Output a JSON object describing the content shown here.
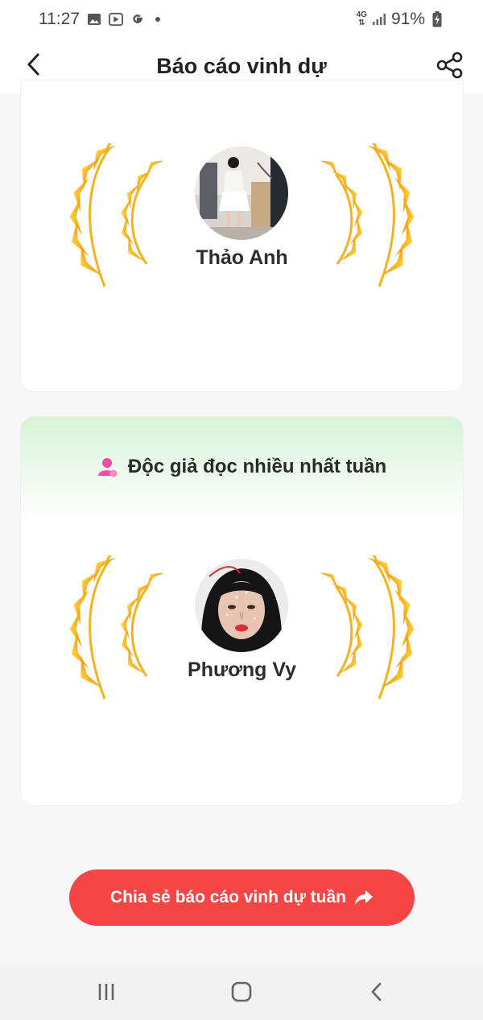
{
  "status_bar": {
    "time": "11:27",
    "network": "4G",
    "battery": "91%"
  },
  "app_bar": {
    "title": "Báo cáo vinh dự"
  },
  "card1": {
    "name": "Thảo Anh"
  },
  "card2": {
    "title": "Độc giả đọc nhiều nhất tuần",
    "name": "Phương Vy"
  },
  "share_button": {
    "label": "Chia sẻ báo cáo vinh dự tuần"
  },
  "colors": {
    "accent": "#f54545",
    "laurel_light": "#ffc01e",
    "laurel_dark": "#f5a10a",
    "header_green": "#d6f3d8",
    "icon_pink": "#ee4fa0"
  }
}
